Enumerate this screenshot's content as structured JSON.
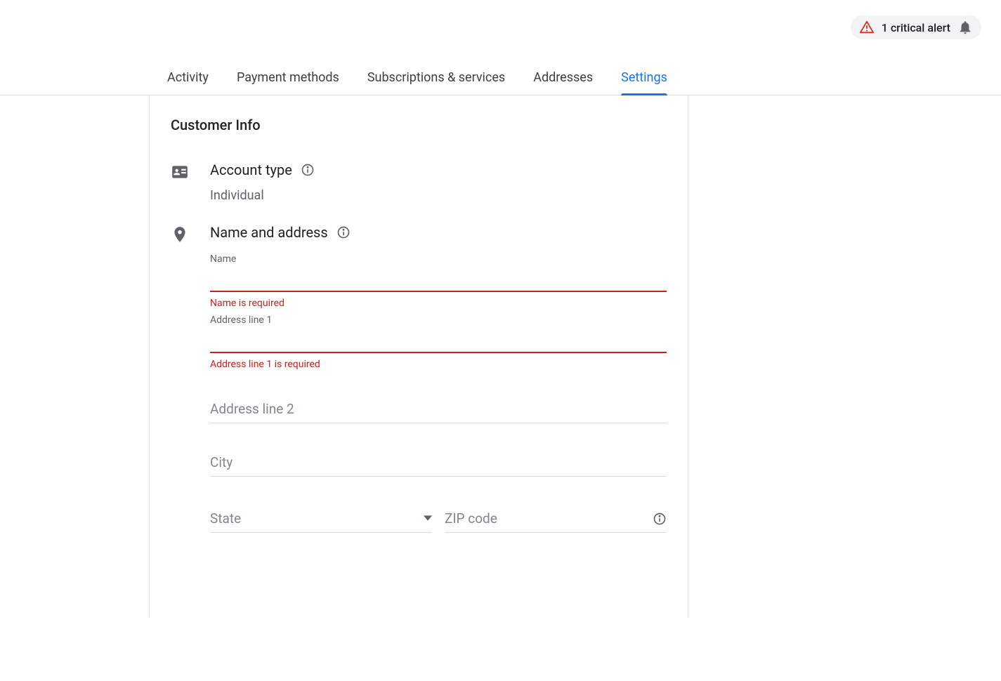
{
  "alert": {
    "text": "1 critical alert"
  },
  "tabs": {
    "activity": "Activity",
    "payment_methods": "Payment methods",
    "subscriptions": "Subscriptions & services",
    "addresses": "Addresses",
    "settings": "Settings"
  },
  "panel": {
    "title": "Customer Info",
    "account_type": {
      "label": "Account type",
      "value": "Individual"
    },
    "name_address": {
      "label": "Name and address",
      "name": {
        "label": "Name",
        "value": "",
        "error": "Name is required"
      },
      "addr1": {
        "label": "Address line 1",
        "value": "",
        "error": "Address line 1 is required"
      },
      "addr2": {
        "placeholder": "Address line 2",
        "value": ""
      },
      "city": {
        "placeholder": "City",
        "value": ""
      },
      "state": {
        "placeholder": "State",
        "value": ""
      },
      "zip": {
        "placeholder": "ZIP code",
        "value": ""
      }
    }
  },
  "colors": {
    "accent": "#1a73e8",
    "error": "#c5221f",
    "muted": "#5f6368"
  }
}
